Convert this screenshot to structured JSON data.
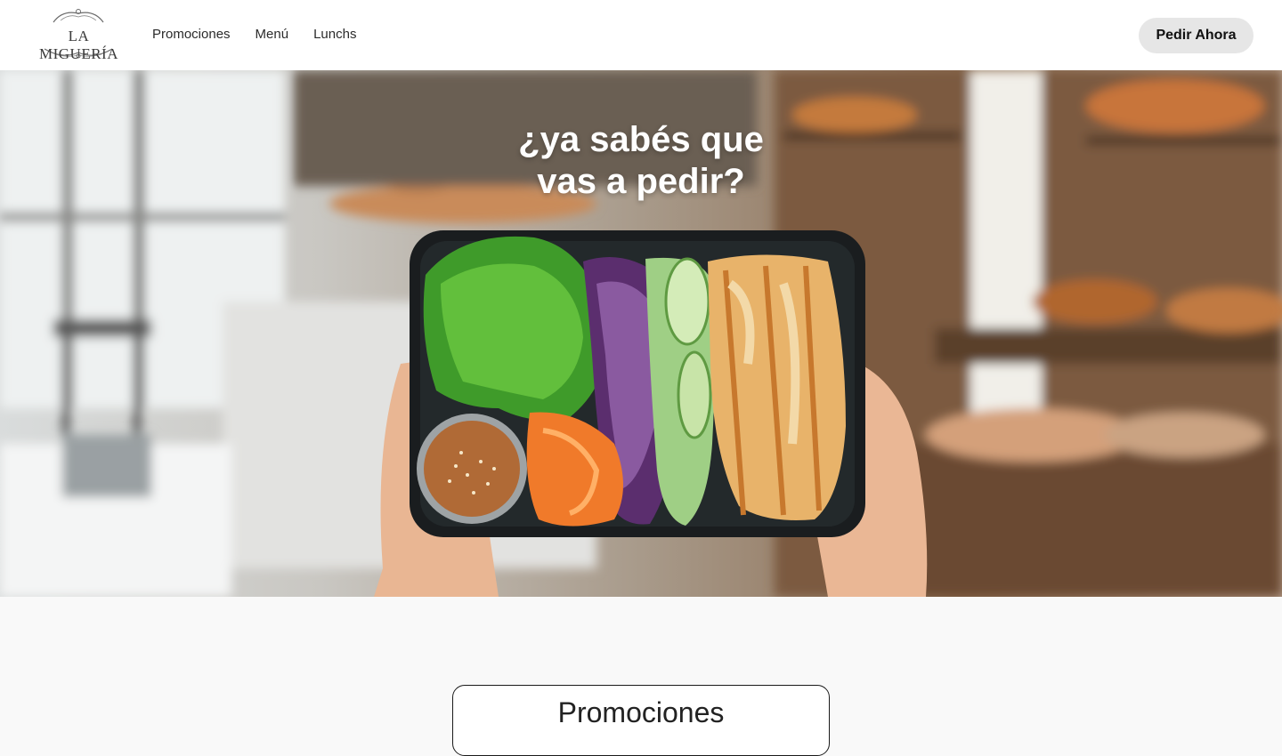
{
  "header": {
    "logo_text": "LA MIGUERÍA",
    "nav": [
      {
        "label": "Promociones"
      },
      {
        "label": "Menú"
      },
      {
        "label": "Lunchs"
      }
    ],
    "cta_label": "Pedir Ahora"
  },
  "hero": {
    "title_line1": "¿ya sabés que",
    "title_line2": "vas a pedir?"
  },
  "section": {
    "title": "Promociones"
  },
  "colors": {
    "header_bg": "#ffffff",
    "cta_bg": "#e6e6e6",
    "hero_text": "#ffffff",
    "page_bg": "#f9f9f9"
  }
}
